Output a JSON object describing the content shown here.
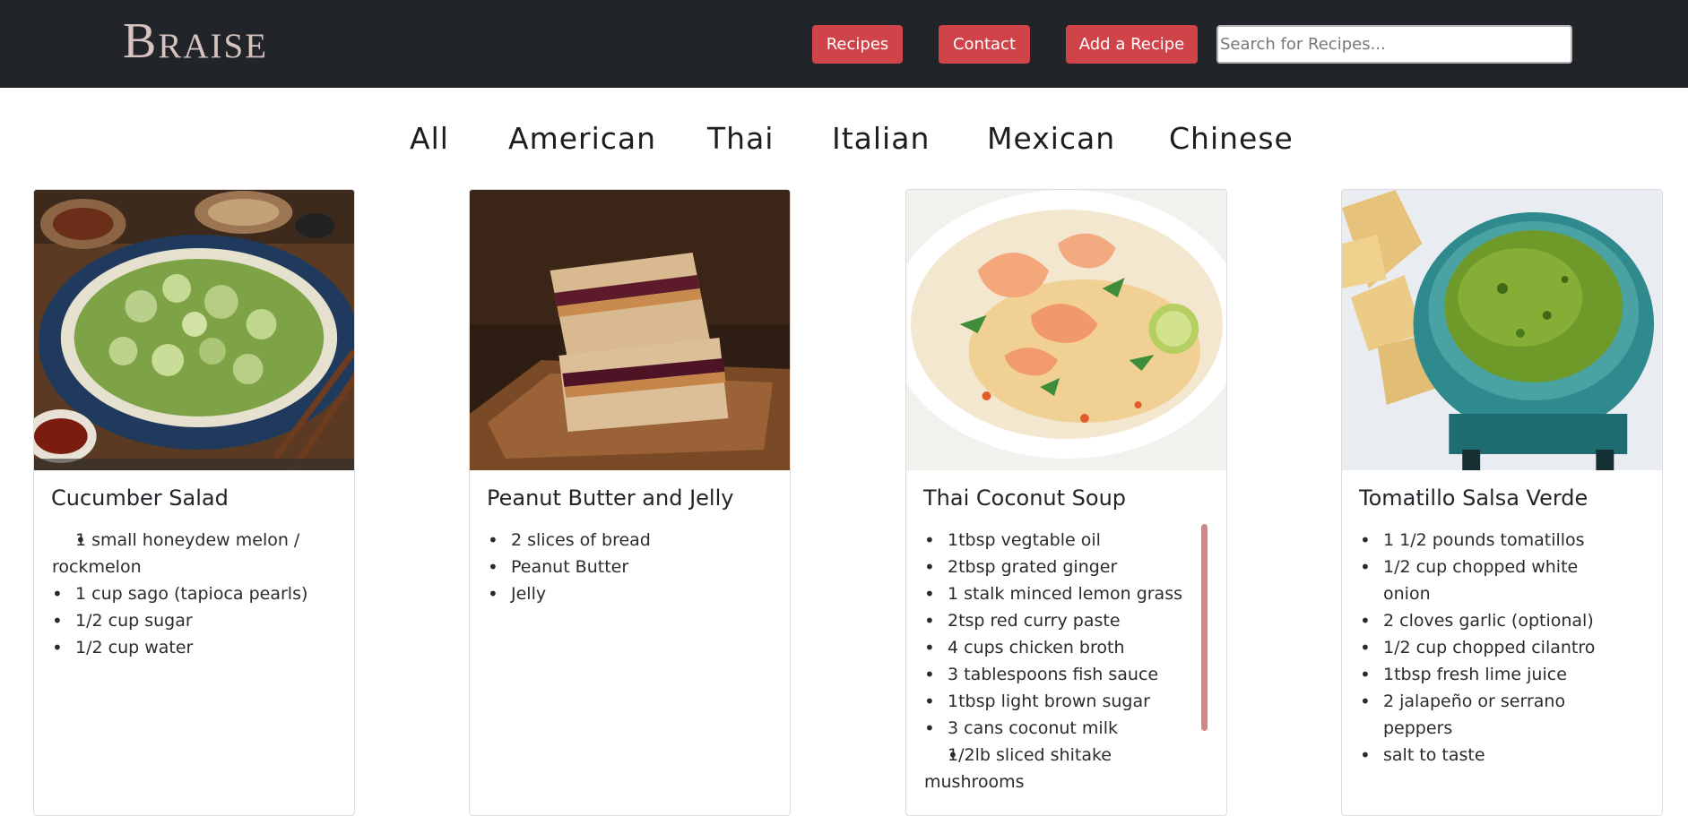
{
  "nav": {
    "brand": "Braise",
    "buttons": [
      "Recipes",
      "Contact",
      "Add a Recipe"
    ],
    "search_placeholder": "Search for Recipes..."
  },
  "filters": [
    "All",
    "American",
    "Thai",
    "Italian",
    "Mexican",
    "Chinese"
  ],
  "cards": [
    {
      "title": "Cucumber Salad",
      "ingredients": [
        "1 small honeydew melon / rockmelon",
        "1 cup sago (tapioca pearls)",
        "1/2 cup sugar",
        "1/2 cup water"
      ]
    },
    {
      "title": "Peanut Butter and Jelly",
      "ingredients": [
        "2 slices of bread",
        "Peanut Butter",
        "Jelly"
      ]
    },
    {
      "title": "Thai Coconut Soup",
      "ingredients": [
        "1tbsp vegtable oil",
        "2tbsp grated ginger",
        "1 stalk minced lemon grass",
        "2tsp red curry paste",
        "4 cups chicken broth",
        "3 tablespoons fish sauce",
        "1tbsp light brown sugar",
        "3 cans coconut milk",
        "1/2lb sliced shitake mushrooms"
      ]
    },
    {
      "title": "Tomatillo Salsa Verde",
      "ingredients": [
        "1 1/2 pounds tomatillos",
        "1/2 cup chopped white onion",
        "2 cloves garlic (optional)",
        "1/2 cup chopped cilantro",
        "1tbsp fresh lime juice",
        "2 jalapeño or serrano peppers",
        "salt to taste"
      ]
    }
  ],
  "colors": {
    "navbar": "#212428",
    "accent": "#cf4349",
    "brand": "#d6c2c0"
  }
}
